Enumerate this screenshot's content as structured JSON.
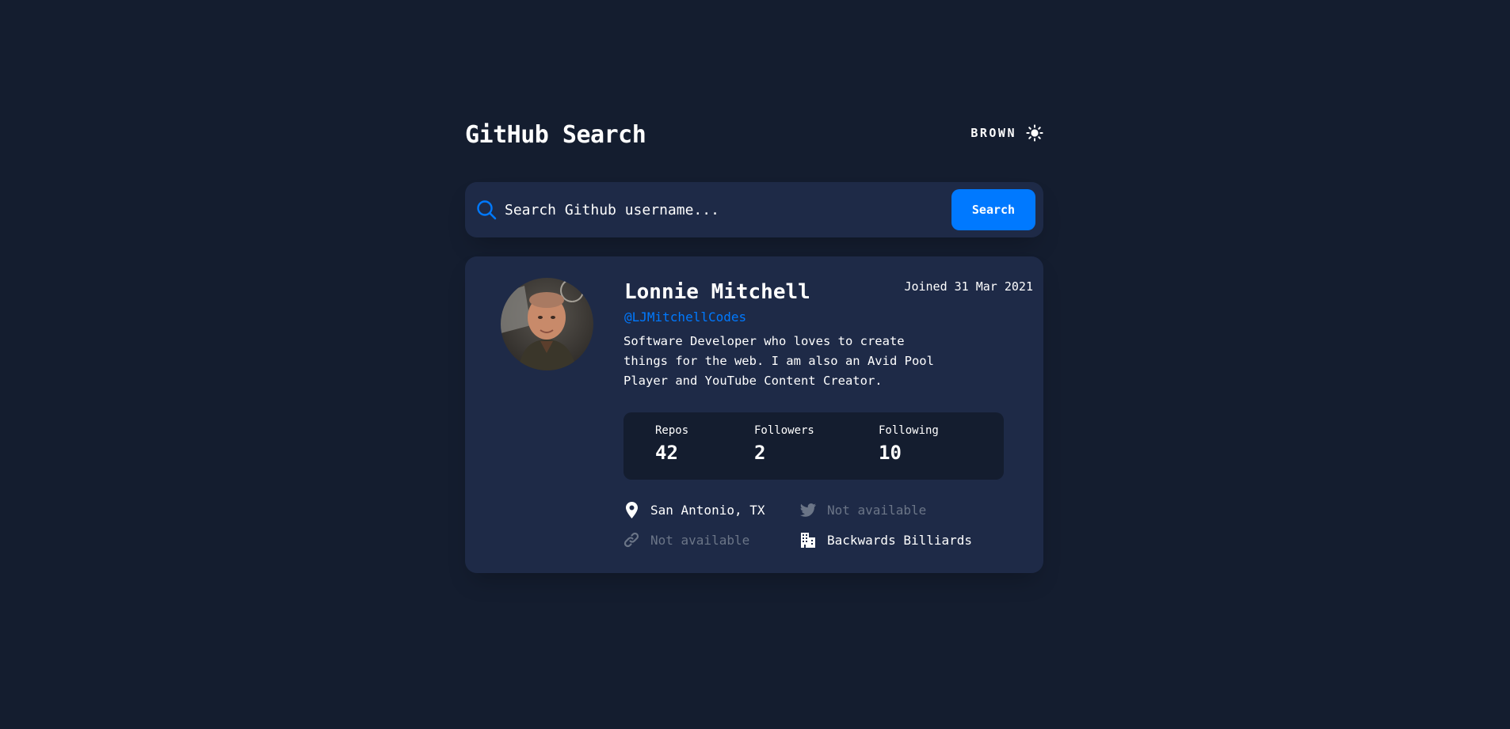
{
  "header": {
    "title": "GitHub Search",
    "theme_label": "BROWN",
    "theme_icon": "sun-icon"
  },
  "search": {
    "placeholder": "Search Github username...",
    "button_label": "Search",
    "icon": "search-icon"
  },
  "profile": {
    "name": "Lonnie Mitchell",
    "login": "@LJMitchellCodes",
    "joined": "Joined 31 Mar 2021",
    "bio": "Software Developer who loves to create things for the web. I am also an Avid Pool Player and YouTube Content Creator.",
    "stats": {
      "repos_label": "Repos",
      "repos_value": "42",
      "followers_label": "Followers",
      "followers_value": "2",
      "following_label": "Following",
      "following_value": "10"
    },
    "info": {
      "location": "San Antonio, TX",
      "blog": "Not available",
      "twitter": "Not available",
      "company": "Backwards Billiards"
    }
  },
  "colors": {
    "background": "#141d2f",
    "card": "#1e2a47",
    "accent": "#0079ff",
    "muted": "#6b7587",
    "text": "#ffffff"
  }
}
